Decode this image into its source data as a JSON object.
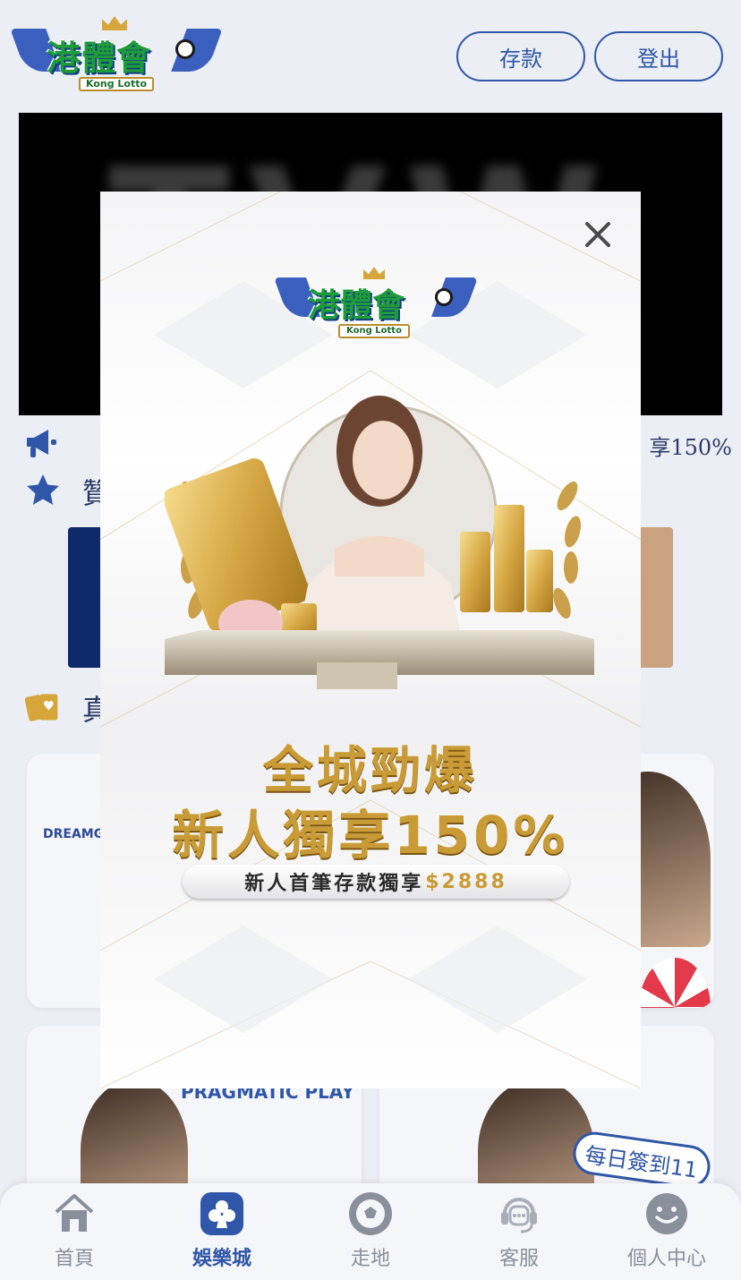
{
  "header": {
    "logo_text": "港體會",
    "logo_sub": "Kong Lotto",
    "deposit_label": "存款",
    "logout_label": "登出"
  },
  "banner": {
    "text": "TVW"
  },
  "marquee": {
    "text": "享150%"
  },
  "sections": {
    "sponsor_label": "贊",
    "games_label": "真"
  },
  "cards": {
    "dg_label": "DREAMG",
    "pragmatic_label": "PRAGMATIC PLAY",
    "checkin_label": "每日簽到11"
  },
  "modal": {
    "logo_text": "港體會",
    "logo_sub": "Kong Lotto",
    "headline_1": "全城勁爆",
    "headline_2": "新人獨享150%",
    "subline": "新人首筆存款獨享",
    "amount": "$2888",
    "close_icon": "close-icon"
  },
  "bottom_nav": [
    {
      "label": "首頁",
      "icon": "home-icon",
      "active": false
    },
    {
      "label": "娛樂城",
      "icon": "club-card-icon",
      "active": true
    },
    {
      "label": "走地",
      "icon": "soccer-ball-icon",
      "active": false
    },
    {
      "label": "客服",
      "icon": "customer-service-icon",
      "active": false
    },
    {
      "label": "個人中心",
      "icon": "smiley-icon",
      "active": false
    }
  ],
  "colors": {
    "accent": "#2f56a8",
    "gold": "#c99b36",
    "background": "#ebeef4"
  }
}
